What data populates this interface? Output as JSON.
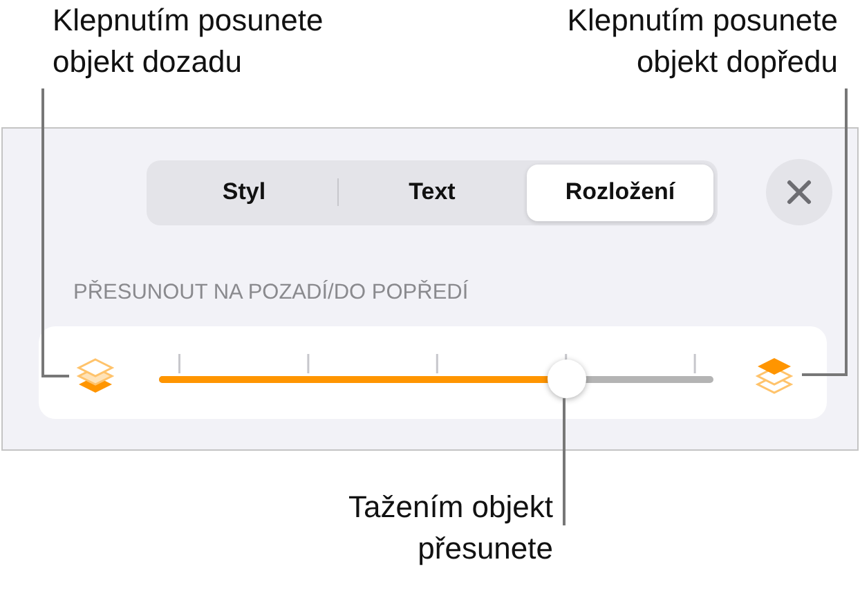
{
  "callouts": [
    {
      "lines": [
        "Klepnutím posunete",
        "objekt dozadu"
      ]
    },
    {
      "lines": [
        "Klepnutím posunete",
        "objekt dopředu"
      ]
    }
  ],
  "tabs": [
    {
      "label": "Styl",
      "selected": false
    },
    {
      "label": "Text",
      "selected": false
    },
    {
      "label": "Rozložení",
      "selected": true
    }
  ],
  "section_label": "PŘESUNOUT NA POZADÍ/DO POPŘEDÍ",
  "slider": {
    "level": 0.735
  },
  "caption": {
    "lines": [
      "Tažením objekt",
      "přesunete"
    ]
  }
}
